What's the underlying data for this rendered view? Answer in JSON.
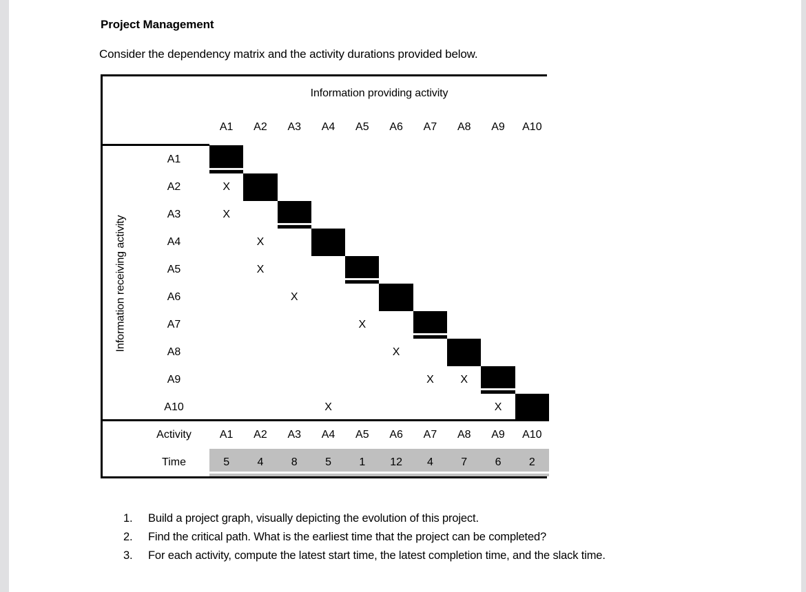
{
  "document": {
    "title": "Project Management",
    "intro": "Consider the dependency matrix and the activity durations provided below."
  },
  "matrix": {
    "column_group_header": "Information providing activity",
    "row_group_header": "Information receiving activity",
    "columns": [
      "A1",
      "A2",
      "A3",
      "A4",
      "A5",
      "A6",
      "A7",
      "A8",
      "A9",
      "A10"
    ],
    "rows": [
      "A1",
      "A2",
      "A3",
      "A4",
      "A5",
      "A6",
      "A7",
      "A8",
      "A9",
      "A10"
    ],
    "mark": "X",
    "diagonal_color": "#000000",
    "cell_color": "#bfbfbf",
    "cells": [
      [
        "",
        "",
        "",
        "",
        "",
        "",
        "",
        "",
        "",
        ""
      ],
      [
        "X",
        "",
        "",
        "",
        "",
        "",
        "",
        "",
        "",
        ""
      ],
      [
        "X",
        "",
        "",
        "",
        "",
        "",
        "",
        "",
        "",
        ""
      ],
      [
        "",
        "X",
        "",
        "",
        "",
        "",
        "",
        "",
        "",
        ""
      ],
      [
        "",
        "X",
        "",
        "",
        "",
        "",
        "",
        "",
        "",
        ""
      ],
      [
        "",
        "",
        "X",
        "",
        "",
        "",
        "",
        "",
        "",
        ""
      ],
      [
        "",
        "",
        "",
        "",
        "X",
        "",
        "",
        "",
        "",
        ""
      ],
      [
        "",
        "",
        "",
        "",
        "",
        "X",
        "",
        "",
        "",
        ""
      ],
      [
        "",
        "",
        "",
        "",
        "",
        "",
        "X",
        "X",
        "",
        ""
      ],
      [
        "",
        "",
        "",
        "X",
        "",
        "",
        "",
        "",
        "X",
        ""
      ]
    ]
  },
  "durations": {
    "activity_label": "Activity",
    "time_label": "Time",
    "activities": [
      "A1",
      "A2",
      "A3",
      "A4",
      "A5",
      "A6",
      "A7",
      "A8",
      "A9",
      "A10"
    ],
    "times": [
      "5",
      "4",
      "8",
      "5",
      "1",
      "12",
      "4",
      "7",
      "6",
      "2"
    ]
  },
  "questions": [
    {
      "num": "1.",
      "text": "Build a project graph, visually depicting the evolution of this project."
    },
    {
      "num": "2.",
      "text": "Find the critical path. What is the earliest time that the project can be completed?"
    },
    {
      "num": "3.",
      "text": "For each activity, compute the latest start time, the latest completion time, and the slack time."
    }
  ]
}
